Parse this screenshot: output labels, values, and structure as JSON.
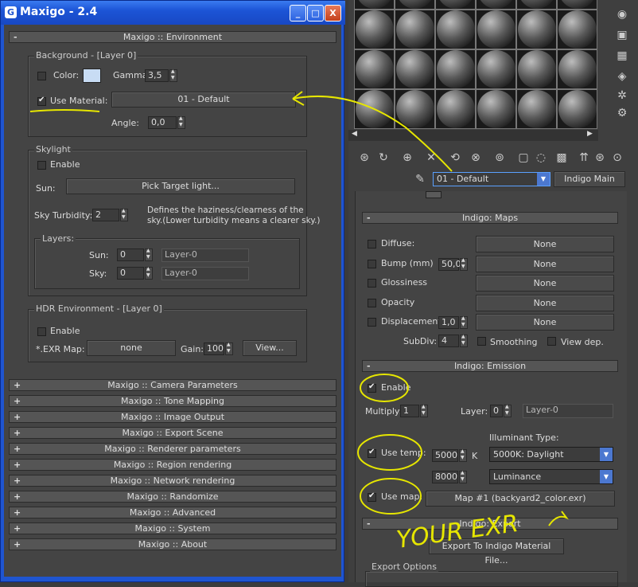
{
  "window": {
    "title": "Maxigo - 2.4",
    "min": "_",
    "max": "□",
    "close": "X"
  },
  "environment": {
    "rollout_title": "Maxigo :: Environment",
    "background": {
      "label": "Background - [Layer 0]",
      "color_label": "Color:",
      "gamma_label": "Gamma:",
      "gamma_value": "3,5",
      "use_material_label": "Use Material:",
      "use_material_checked": true,
      "material_button": "01 - Default",
      "angle_label": "Angle:",
      "angle_value": "0,0"
    },
    "skylight": {
      "label": "Skylight",
      "enable_label": "Enable",
      "sun_label": "Sun:",
      "pick_button": "Pick Target light...",
      "turbidity_label": "Sky Turbidity:",
      "turbidity_value": "2",
      "turbidity_note1": "Defines the haziness/clearness of the",
      "turbidity_note2": "sky.(Lower turbidity means a clearer sky.)",
      "layers_label": "Layers:",
      "sun_layer_label": "Sun:",
      "sun_layer_value": "0",
      "sun_layer_name": "Layer-0",
      "sky_layer_label": "Sky:",
      "sky_layer_value": "0",
      "sky_layer_name": "Layer-0"
    },
    "hdr": {
      "label": "HDR Environment - [Layer 0]",
      "enable_label": "Enable",
      "exr_label": "*.EXR Map:",
      "exr_button": "none",
      "gain_label": "Gain:",
      "gain_value": "100",
      "view_button": "View..."
    }
  },
  "rollouts": [
    "Maxigo :: Camera Parameters",
    "Maxigo :: Tone Mapping",
    "Maxigo :: Image Output",
    "Maxigo :: Export Scene",
    "Maxigo :: Renderer parameters",
    "Maxigo :: Region rendering",
    "Maxigo :: Network rendering",
    "Maxigo :: Randomize",
    "Maxigo :: Advanced",
    "Maxigo :: System",
    "Maxigo :: About"
  ],
  "material_editor": {
    "material_name": "01 - Default",
    "material_type": "Indigo Main",
    "maps": {
      "title": "Indigo: Maps",
      "rows": [
        {
          "label": "Diffuse:",
          "button": "None"
        },
        {
          "label": "Bump (mm)",
          "value": "50,0",
          "button": "None"
        },
        {
          "label": "Glossiness",
          "button": "None"
        },
        {
          "label": "Opacity",
          "button": "None"
        },
        {
          "label": "Displacement",
          "value": "1,0",
          "button": "None"
        }
      ],
      "subdiv_label": "SubDiv:",
      "subdiv_value": "4",
      "smoothing_label": "Smoothing",
      "view_dep_label": "View dep."
    },
    "emission": {
      "title": "Indigo: Emission",
      "enable_label": "Enable",
      "multiply_label": "Multiply:",
      "multiply_value": "1",
      "layer_label": "Layer:",
      "layer_value": "0",
      "layer_name": "Layer-0",
      "illuminant_label": "Illuminant Type:",
      "use_temp_label": "Use temp:",
      "temp_value": "5000",
      "temp_unit": "K",
      "illuminant_value": "5000K: Daylight",
      "lum_value": "8000",
      "lum_type": "Luminance",
      "use_map_label": "Use map:",
      "map_button": "Map #1 (backyard2_color.exr)"
    },
    "export": {
      "title": "Indigo: Export",
      "export_button": "Export To Indigo Material File...",
      "options_label": "Export Options"
    }
  },
  "annotation_text": "YOUR EXR"
}
